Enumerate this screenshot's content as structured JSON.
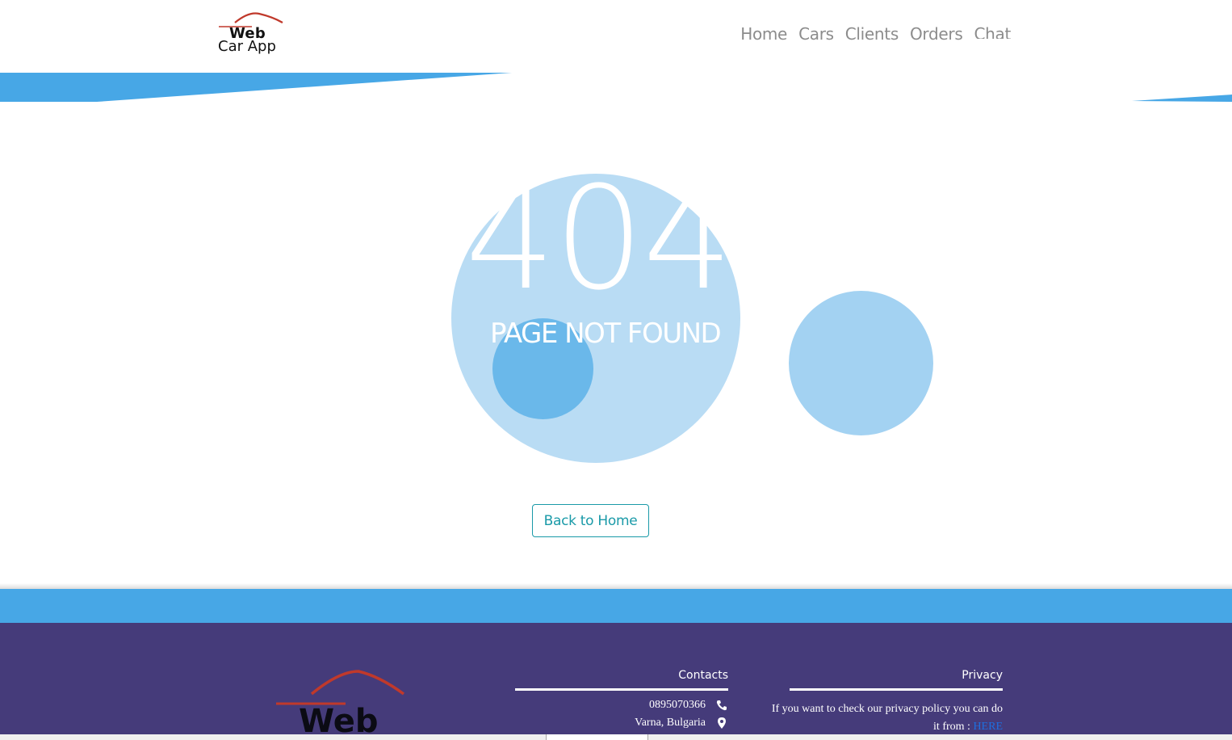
{
  "brand": {
    "line1": "Web",
    "line2": "Car App"
  },
  "nav": {
    "items": [
      "Home",
      "Cars",
      "Clients",
      "Orders",
      "Chat"
    ]
  },
  "error": {
    "code": "404",
    "message": "PAGE NOT FOUND",
    "back_label": "Back to Home"
  },
  "footer": {
    "brand_text": "Web",
    "contacts": {
      "title": "Contacts",
      "phone": "0895070366",
      "address": "Varna, Bulgaria"
    },
    "privacy": {
      "title": "Privacy",
      "text": "If you want to check our privacy policy you can do it from :",
      "link_label": "HERE"
    }
  },
  "colors": {
    "accent_blue": "#47a7e6",
    "footer_bg": "#453b7a",
    "button_teal": "#1a9aa8",
    "logo_red": "#c0392b"
  },
  "icons": {
    "phone": "phone-icon",
    "location": "map-pin-icon",
    "logo": "car-roof-logo-icon"
  }
}
